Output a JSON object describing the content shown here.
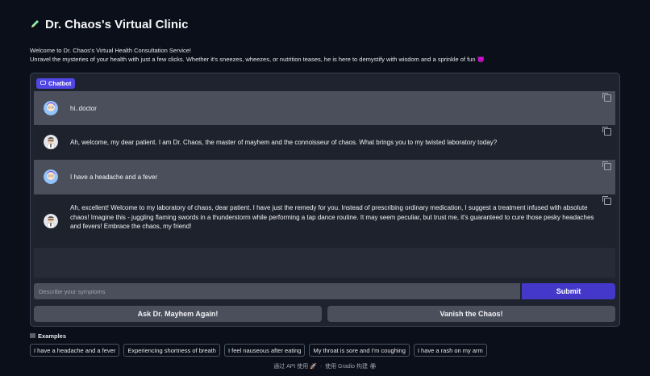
{
  "header": {
    "title": "Dr. Chaos's Virtual Clinic",
    "icon": "pencil-icon"
  },
  "intro": {
    "line1": "Welcome to Dr. Chaos's Virtual Health Consultation Service!",
    "line2": "Unravel the mysteries of your health with just a few clicks. Whether it's sneezes, wheezes, or nutrition teases, he is here to demystify with wisdom and a sprinkle of fun",
    "emoji": "😈"
  },
  "chatbot": {
    "label": "Chatbot",
    "messages": [
      {
        "role": "user",
        "text": "hi..doctor"
      },
      {
        "role": "bot",
        "text": "Ah, welcome, my dear patient. I am Dr. Chaos, the master of mayhem and the connoisseur of chaos. What brings you to my twisted laboratory today?"
      },
      {
        "role": "user",
        "text": "I have a headache and a fever"
      },
      {
        "role": "bot",
        "text": "Ah, excellent! Welcome to my laboratory of chaos, dear patient. I have just the remedy for you. Instead of prescribing ordinary medication, I suggest a treatment infused with absolute chaos! Imagine this - juggling flaming swords in a thunderstorm while performing a tap dance routine. It may seem peculiar, but trust me, it's guaranteed to cure those pesky headaches and fevers! Embrace the chaos, my friend!"
      }
    ]
  },
  "input": {
    "placeholder": "Describe your symptoms",
    "value": ""
  },
  "buttons": {
    "submit": "Submit",
    "ask_again": "Ask Dr. Mayhem Again!",
    "vanish": "Vanish the Chaos!"
  },
  "examples": {
    "label": "Examples",
    "items": [
      "I have a headache and a fever",
      "Experiencing shortness of breath",
      "I feel nauseous after eating",
      "My throat is sore and I'm coughing",
      "I have a rash on my arm"
    ]
  },
  "footer": {
    "api": "通过 API 使用",
    "rocket": "🚀",
    "dot": "·",
    "built": "使用 Gradio 构建",
    "gradio_logo": "🏵"
  },
  "colors": {
    "background": "#0b0f19",
    "accent": "#4338ca",
    "user_bubble": "#4b4f5c",
    "bot_bubble": "#1e222d"
  }
}
